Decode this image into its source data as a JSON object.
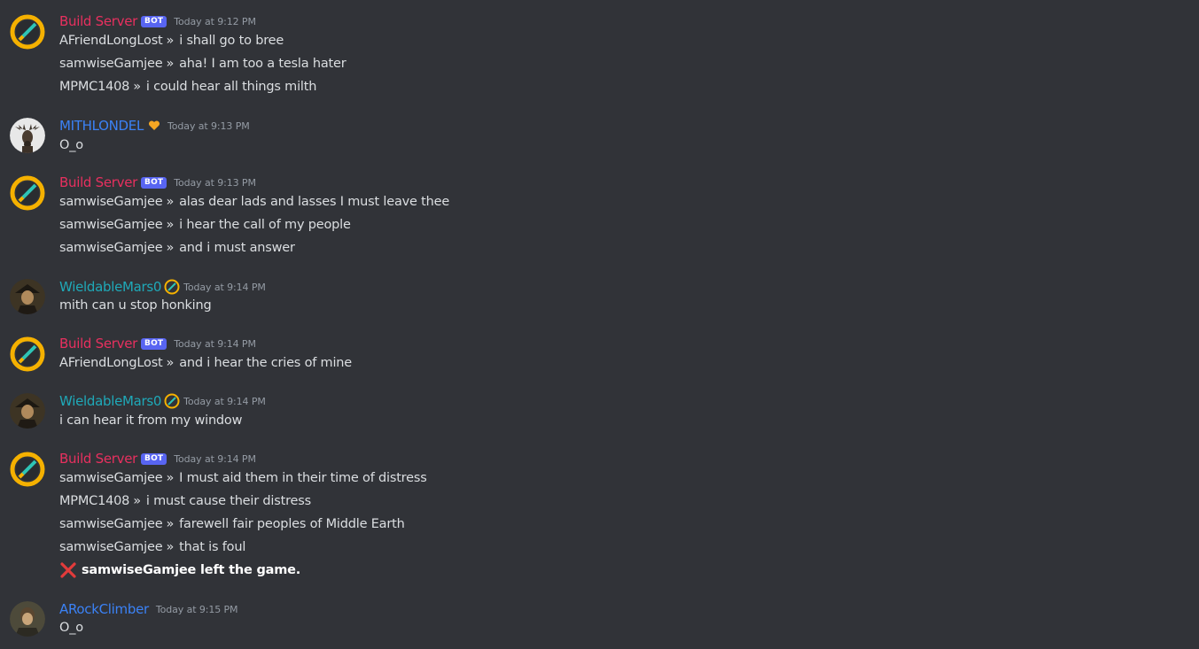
{
  "colors": {
    "background": "#313338",
    "bot_name": "#e8305f",
    "blue_name": "#3b82f6",
    "teal_name": "#1fa9b8",
    "bot_tag": "#5865f2",
    "timestamp": "#949ba4",
    "text": "#dbdee1"
  },
  "separator": "»",
  "groups": [
    {
      "username": "Build Server",
      "bot_tag": "BOT",
      "timestamp": "Today at 9:12 PM",
      "lines": [
        {
          "sender": "AFriendLongLost",
          "text": "i shall go to bree"
        },
        {
          "sender": "samwiseGamjee",
          "text": "aha! I am too a tesla hater"
        },
        {
          "sender": "MPMC1408",
          "text": "i could hear all things milth"
        }
      ]
    },
    {
      "username": "MITHLONDEL",
      "role_icon": "orange-heart-icon",
      "timestamp": "Today at 9:13 PM",
      "text": "O_o"
    },
    {
      "username": "Build Server",
      "bot_tag": "BOT",
      "timestamp": "Today at 9:13 PM",
      "lines": [
        {
          "sender": "samwiseGamjee",
          "text": "alas dear lads and lasses I must leave thee"
        },
        {
          "sender": "samwiseGamjee",
          "text": "i hear the call of my people"
        },
        {
          "sender": "samwiseGamjee",
          "text": "and i must answer"
        }
      ]
    },
    {
      "username": "WieldableMars0",
      "role_icon": "server-ring-icon",
      "timestamp": "Today at 9:14 PM",
      "text": "mith can u stop honking"
    },
    {
      "username": "Build Server",
      "bot_tag": "BOT",
      "timestamp": "Today at 9:14 PM",
      "lines": [
        {
          "sender": "AFriendLongLost",
          "text": "and i hear the cries of mine"
        }
      ]
    },
    {
      "username": "WieldableMars0",
      "role_icon": "server-ring-icon",
      "timestamp": "Today at 9:14 PM",
      "text": "i can hear it from my window"
    },
    {
      "username": "Build Server",
      "bot_tag": "BOT",
      "timestamp": "Today at 9:14 PM",
      "lines": [
        {
          "sender": "samwiseGamjee",
          "text": "I must aid them in their time of distress"
        },
        {
          "sender": "MPMC1408",
          "text": "i must cause their distress"
        },
        {
          "sender": "samwiseGamjee",
          "text": "farewell fair peoples of Middle Earth"
        },
        {
          "sender": "samwiseGamjee",
          "text": "that is foul"
        }
      ],
      "left_message": {
        "icon": "red-x-icon",
        "text": "samwiseGamjee left the game."
      }
    },
    {
      "username": "ARockClimber",
      "timestamp": "Today at 9:15 PM",
      "text": "O_o"
    }
  ]
}
